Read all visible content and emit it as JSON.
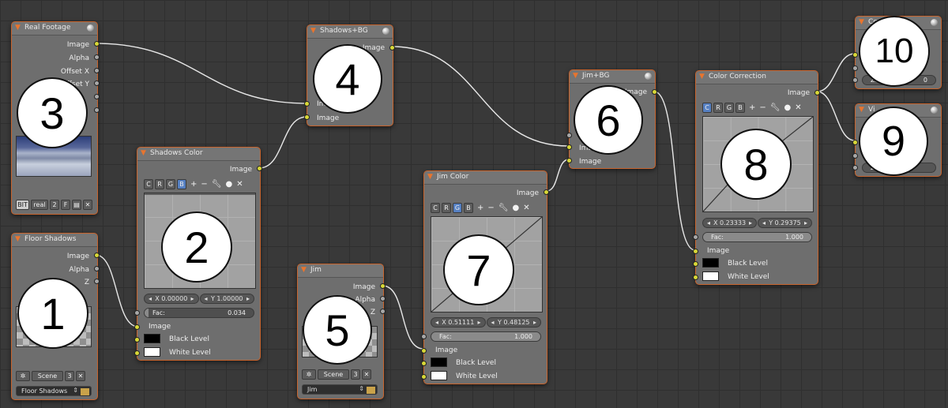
{
  "nodes": {
    "real_footage": {
      "title": "Real Footage",
      "outputs": [
        "Image",
        "Alpha",
        "Offset X",
        "Offset Y",
        "",
        ""
      ],
      "image_field": "real",
      "frames": "2",
      "f_label": "F",
      "bit_label": "BIT"
    },
    "floor_shadows": {
      "title": "Floor Shadows",
      "outputs": [
        "Image",
        "Alpha",
        "Z"
      ],
      "scene_label": "Scene",
      "scene_count": "3",
      "layer": "Floor Shadows"
    },
    "shadows_color": {
      "title": "Shadows Color",
      "output": "Image",
      "channels": [
        "C",
        "R",
        "G",
        "B"
      ],
      "active_channel": "B",
      "x": "X 0.00000",
      "y": "Y 1.00000",
      "fac_label": "Fac:",
      "fac_value": "0.034",
      "fac_fraction": 0.034,
      "inputs": [
        "Image",
        "Black Level",
        "White Level"
      ]
    },
    "shadows_bg": {
      "title": "Shadows+BG",
      "output": "Image",
      "inputs": [
        "Image",
        "Image"
      ]
    },
    "jim": {
      "title": "Jim",
      "outputs": [
        "Image",
        "Alpha",
        "Z"
      ],
      "scene_label": "Scene",
      "scene_count": "3",
      "layer": "Jim"
    },
    "jim_bg": {
      "title": "Jim+BG",
      "output": "Image",
      "inputs": [
        "Image",
        "Image"
      ]
    },
    "jim_color": {
      "title": "Jim Color",
      "output": "Image",
      "channels": [
        "C",
        "R",
        "G",
        "B"
      ],
      "active_channel": "G",
      "x": "X 0.51111",
      "y": "Y 0.48125",
      "fac_label": "Fac:",
      "fac_value": "1.000",
      "fac_fraction": 1.0,
      "inputs": [
        "Image",
        "Black Level",
        "White Level"
      ]
    },
    "color_correction": {
      "title": "Color Correction",
      "output": "Image",
      "channels": [
        "C",
        "R",
        "G",
        "B"
      ],
      "active_channel": "C",
      "x": "X 0.23333",
      "y": "Y 0.29375",
      "fac_label": "Fac:",
      "fac_value": "1.000",
      "fac_fraction": 1.0,
      "inputs": [
        "Image",
        "Black Level",
        "White Level"
      ]
    },
    "composite": {
      "title": "Co",
      "z_label": "Z:",
      "z_value": "0"
    },
    "viewer": {
      "title": "Vi",
      "z_label": "Z:"
    }
  },
  "badges": [
    "1",
    "2",
    "3",
    "4",
    "5",
    "6",
    "7",
    "8",
    "9",
    "10"
  ],
  "colors": {
    "socket_image": "#d8d837",
    "socket_value": "#a8a8a8",
    "node_border": "#c8642d",
    "active_channel": "#5680c2"
  },
  "icons": {
    "collapse": "triangle-down-icon",
    "preview": "sphere-icon",
    "tools": [
      "plus-icon",
      "minus-icon",
      "wrench-icon",
      "dot-icon",
      "x-icon"
    ]
  }
}
